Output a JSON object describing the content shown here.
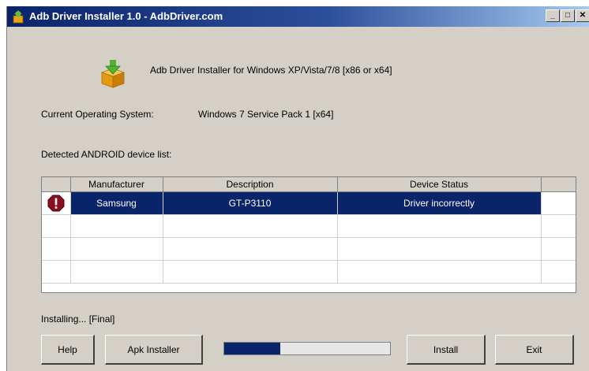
{
  "window": {
    "title": "Adb Driver Installer 1.0  -  AdbDriver.com",
    "buttons": {
      "minimize": "_",
      "maximize": "□",
      "close": "✕"
    }
  },
  "header": {
    "heading": "Adb Driver Installer for Windows XP/Vista/7/8 [x86 or x64]"
  },
  "os": {
    "label": "Current Operating System:",
    "value": "Windows 7 Service Pack 1 [x64]"
  },
  "devices": {
    "label": "Detected ANDROID device list:",
    "columns": [
      "Manufacturer",
      "Description",
      "Device Status"
    ],
    "rows": [
      {
        "manufacturer": "Samsung",
        "description": "GT-P3110",
        "status": "Driver incorrectly",
        "icon": "stop-icon"
      }
    ]
  },
  "status": {
    "text": "Installing... [Final]"
  },
  "progress": {
    "fraction": 0.34
  },
  "buttons": {
    "help": "Help",
    "apk_installer": "Apk Installer",
    "install": "Install",
    "exit": "Exit"
  },
  "colors": {
    "title_bar": "#0a246a",
    "selection": "#0a246a",
    "progress": "#0a246a",
    "face": "#d4d0c8"
  }
}
